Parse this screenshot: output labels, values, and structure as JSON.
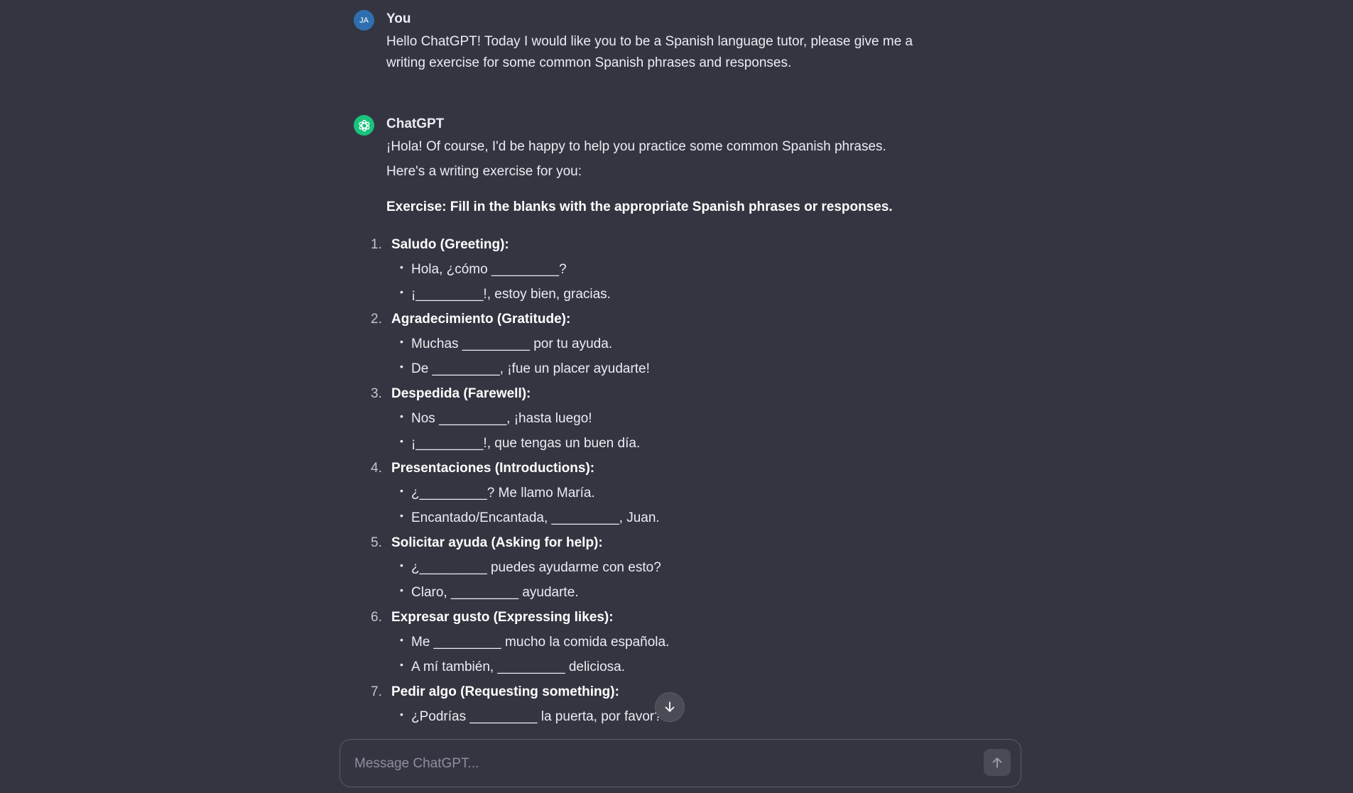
{
  "composer": {
    "placeholder": "Message ChatGPT..."
  },
  "messages": {
    "user": {
      "avatar_initials": "JA",
      "author": "You",
      "text_line1": "Hello ChatGPT! Today I would like you to be a Spanish language tutor, please give me a",
      "text_line2": "writing exercise for some common Spanish phrases and responses."
    },
    "assistant": {
      "author": "ChatGPT",
      "intro_line1": "¡Hola! Of course, I'd be happy to help you practice some common Spanish phrases.",
      "intro_line2": "Here's a writing exercise for you:",
      "exercise_title": "Exercise: Fill in the blanks with the appropriate Spanish phrases or responses.",
      "sections": [
        {
          "num": "1.",
          "title": "Saludo (Greeting):",
          "items": [
            "Hola, ¿cómo _________?",
            "¡_________!, estoy bien, gracias."
          ]
        },
        {
          "num": "2.",
          "title": "Agradecimiento (Gratitude):",
          "items": [
            "Muchas _________ por tu ayuda.",
            "De _________, ¡fue un placer ayudarte!"
          ]
        },
        {
          "num": "3.",
          "title": "Despedida (Farewell):",
          "items": [
            "Nos _________, ¡hasta luego!",
            "¡_________!, que tengas un buen día."
          ]
        },
        {
          "num": "4.",
          "title": "Presentaciones (Introductions):",
          "items": [
            "¿_________? Me llamo María.",
            "Encantado/Encantada, _________, Juan."
          ]
        },
        {
          "num": "5.",
          "title": "Solicitar ayuda (Asking for help):",
          "items": [
            "¿_________ puedes ayudarme con esto?",
            "Claro, _________ ayudarte."
          ]
        },
        {
          "num": "6.",
          "title": "Expresar gusto (Expressing likes):",
          "items": [
            "Me _________ mucho la comida española.",
            "A mí también, _________ deliciosa."
          ]
        },
        {
          "num": "7.",
          "title": "Pedir algo (Requesting something):",
          "items": [
            "¿Podrías _________ la puerta, por favor?"
          ]
        }
      ]
    }
  },
  "icons": {
    "assistant_avatar": "openai-logo-icon",
    "scroll": "arrow-down-icon",
    "send": "arrow-up-icon"
  },
  "colors": {
    "background": "#343541",
    "assistant_avatar": "#19c37d",
    "user_avatar": "#2f6fb0"
  }
}
